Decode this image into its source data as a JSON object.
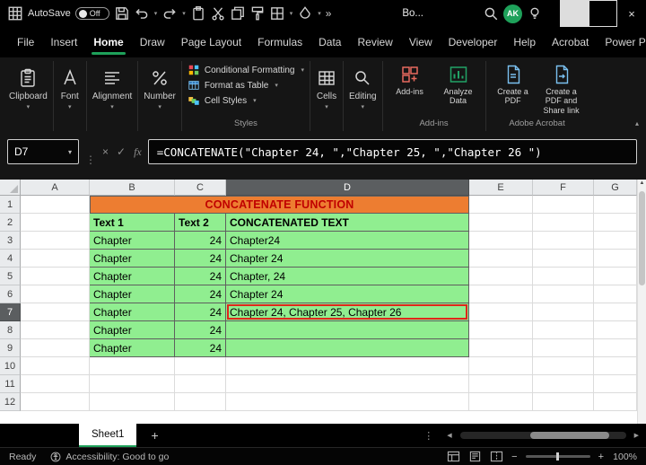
{
  "titlebar": {
    "autosave_label": "AutoSave",
    "autosave_state": "Off",
    "quick_access_icons": [
      "save",
      "undo",
      "redo",
      "paste",
      "cut",
      "copy",
      "format-painter",
      "borders",
      "fill-color"
    ],
    "overflow_icon": "more-commands",
    "workbook_name": "Bo...",
    "avatar_initials": "AK"
  },
  "menubar": {
    "items": [
      {
        "label": "File",
        "active": false
      },
      {
        "label": "Insert",
        "active": false
      },
      {
        "label": "Home",
        "active": true
      },
      {
        "label": "Draw",
        "active": false
      },
      {
        "label": "Page Layout",
        "active": false
      },
      {
        "label": "Formulas",
        "active": false
      },
      {
        "label": "Data",
        "active": false
      },
      {
        "label": "Review",
        "active": false
      },
      {
        "label": "View",
        "active": false
      },
      {
        "label": "Developer",
        "active": false
      },
      {
        "label": "Help",
        "active": false
      },
      {
        "label": "Acrobat",
        "active": false
      },
      {
        "label": "Power Pivot",
        "active": false
      }
    ]
  },
  "ribbon": {
    "groups": [
      {
        "type": "big",
        "label": "Clipboard",
        "icon": "clipboard"
      },
      {
        "type": "big",
        "label": "Font",
        "icon": "font"
      },
      {
        "type": "big",
        "label": "Alignment",
        "icon": "alignment"
      },
      {
        "type": "big",
        "label": "Number",
        "icon": "number"
      },
      {
        "type": "stack",
        "label": "Styles",
        "items": [
          {
            "label": "Conditional Formatting",
            "icon": "conditional-formatting"
          },
          {
            "label": "Format as Table",
            "icon": "format-as-table"
          },
          {
            "label": "Cell Styles",
            "icon": "cell-styles"
          }
        ]
      },
      {
        "type": "big",
        "label": "Cells",
        "icon": "cells"
      },
      {
        "type": "big",
        "label": "Editing",
        "icon": "editing"
      },
      {
        "type": "duo",
        "label": "Add-ins",
        "items": [
          {
            "label": "Add-ins",
            "icon": "add-ins"
          },
          {
            "label": "Analyze Data",
            "icon": "analyze-data"
          }
        ]
      },
      {
        "type": "duo",
        "label": "Adobe Acrobat",
        "items": [
          {
            "label": "Create a PDF",
            "icon": "create-pdf"
          },
          {
            "label": "Create a PDF and Share link",
            "icon": "create-pdf-share"
          }
        ]
      }
    ]
  },
  "formula_bar": {
    "name_box": "D7",
    "fx_label": "fx",
    "formula": "=CONCATENATE(\"Chapter 24, \",\"Chapter 25, \",\"Chapter 26 \")"
  },
  "grid": {
    "column_headers": [
      "A",
      "B",
      "C",
      "D",
      "E",
      "F",
      "G"
    ],
    "row_headers": [
      "1",
      "2",
      "3",
      "4",
      "5",
      "6",
      "7",
      "8",
      "9",
      "10",
      "11",
      "12"
    ],
    "selected_column": "D",
    "selected_row": "7",
    "banner_text": "CONCATENATE FUNCTION",
    "table_headers": [
      "Text 1",
      "Text 2",
      "CONCATENATED TEXT"
    ],
    "rows": [
      {
        "text1": "Chapter",
        "text2": "24",
        "result": "Chapter24",
        "highlighted": false
      },
      {
        "text1": "Chapter",
        "text2": "24",
        "result": "Chapter 24",
        "highlighted": false
      },
      {
        "text1": "Chapter",
        "text2": "24",
        "result": "Chapter, 24",
        "highlighted": false
      },
      {
        "text1": "Chapter",
        "text2": "24",
        "result": "Chapter 24",
        "highlighted": false
      },
      {
        "text1": "Chapter",
        "text2": "24",
        "result": "Chapter 24, Chapter 25, Chapter 26",
        "highlighted": true
      },
      {
        "text1": "Chapter",
        "text2": "24",
        "result": "",
        "highlighted": false
      },
      {
        "text1": "Chapter",
        "text2": "24",
        "result": "",
        "highlighted": false
      }
    ]
  },
  "sheetbar": {
    "tabs": [
      {
        "label": "Sheet1",
        "active": true
      }
    ]
  },
  "statusbar": {
    "mode": "Ready",
    "accessibility": "Accessibility: Good to go",
    "zoom_level": "100%"
  },
  "colors": {
    "accent_green": "#1EA15A",
    "banner_bg": "#ED7D31",
    "banner_text": "#C00000",
    "table_green": "#90EE90",
    "highlight_red": "#E0261B"
  }
}
